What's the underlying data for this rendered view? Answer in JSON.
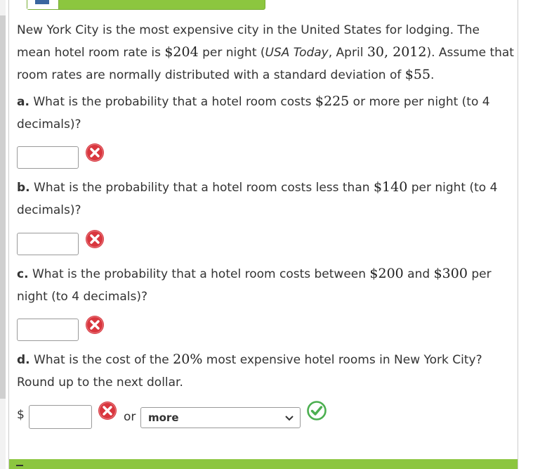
{
  "intro": {
    "text1": "New York City is the most expensive city in the United States for lodging. The mean hotel room rate is ",
    "mean": "$204",
    "text2": " per night (",
    "source": "USA Today",
    "text3": ", April ",
    "day": "30",
    "comma": ", ",
    "year": "2012",
    "text4": "). Assume that room rates are normally distributed with a standard deviation of ",
    "sd": "$55",
    "text5": "."
  },
  "questions": {
    "a": {
      "letter": "a.",
      "text1": " What is the probability that a hotel room costs ",
      "value": "$225",
      "text2": " or more per night (to 4 decimals)?"
    },
    "b": {
      "letter": "b.",
      "text1": " What is the probability that a hotel room costs less than ",
      "value": "$140",
      "text2": " per night (to 4 decimals)?"
    },
    "c": {
      "letter": "c.",
      "text1": " What is the probability that a hotel room costs between ",
      "value1": "$200",
      "mid": " and ",
      "value2": "$300",
      "text2": " per night (to 4 decimals)?"
    },
    "d": {
      "letter": "d.",
      "text1": " What is the cost of the ",
      "value": "20%",
      "text2": " most expensive hotel rooms in New York City? Round up to the next dollar."
    }
  },
  "answers": {
    "a": {
      "value": "",
      "status": "incorrect"
    },
    "b": {
      "value": "",
      "status": "incorrect"
    },
    "c": {
      "value": "",
      "status": "incorrect"
    },
    "d": {
      "currency": "$",
      "value": "",
      "status": "incorrect",
      "or_label": "or",
      "select_value": "more",
      "select_status": "correct"
    }
  },
  "colors": {
    "accent": "#8cc63f",
    "incorrect": "#d9363e",
    "correct": "#4caf50"
  },
  "icons": {
    "incorrect": "x-circle-icon",
    "correct": "check-circle-icon",
    "dropdown": "chevron-down-icon"
  }
}
